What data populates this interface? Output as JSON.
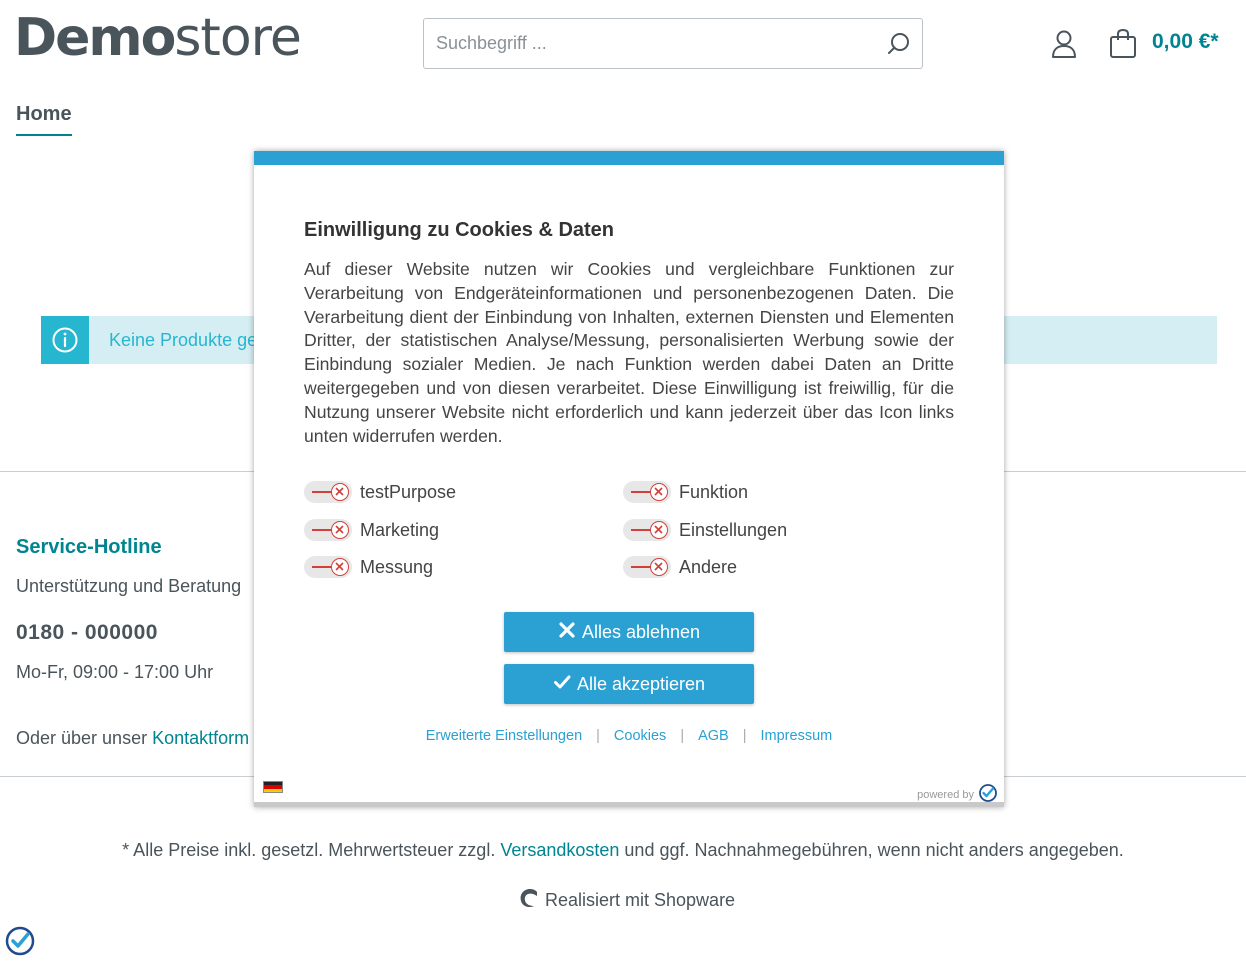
{
  "header": {
    "logo_strong": "Demo",
    "logo_light": "store",
    "search_placeholder": "Suchbegriff ...",
    "cart_total": "0,00 €*"
  },
  "nav": {
    "home": "Home"
  },
  "alert": {
    "text": "Keine Produkte ge"
  },
  "footer": {
    "hotline_title": "Service-Hotline",
    "hotline_sub": "Unterstützung und Beratung",
    "hotline_phone": "0180 - 000000",
    "hotline_hours": "Mo-Fr, 09:00 - 17:00 Uhr",
    "contact_prefix": "Oder über unser ",
    "contact_link": "Kontaktform",
    "price_note_prefix": "* Alle Preise inkl. gesetzl. Mehrwertsteuer zzgl. ",
    "price_note_link": "Versandkosten",
    "price_note_suffix": " und ggf. Nachnahmegebühren, wenn nicht anders angegeben.",
    "shopware": "Realisiert mit Shopware"
  },
  "modal": {
    "title": "Einwilligung zu Cookies & Daten",
    "body": "Auf dieser Website nutzen wir Cookies und vergleichbare Funktionen zur Verarbeitung von Endgeräteinformationen und personenbezogenen Daten. Die Verarbeitung dient der Einbindung von Inhalten, externen Diensten und Elementen Dritter, der statistischen Analyse/Messung, personalisierten Werbung sowie der Einbindung sozialer Medien. Je nach Funktion werden dabei Daten an Dritte weitergegeben und von diesen verarbeitet. Diese Einwilligung ist freiwillig, für die Nutzung unserer Website nicht erforderlich und kann jederzeit über das Icon links unten widerrufen werden.",
    "toggles": [
      {
        "label": "testPurpose",
        "checked": false
      },
      {
        "label": "Funktion",
        "checked": false
      },
      {
        "label": "Marketing",
        "checked": false
      },
      {
        "label": "Einstellungen",
        "checked": false
      },
      {
        "label": "Messung",
        "checked": false
      },
      {
        "label": "Andere",
        "checked": false
      }
    ],
    "reject_label": "Alles ablehnen",
    "accept_label": "Alle akzeptieren",
    "links": {
      "advanced": "Erweiterte Einstellungen",
      "cookies": "Cookies",
      "agb": "AGB",
      "impressum": "Impressum"
    },
    "powered_by": "powered by"
  },
  "colors": {
    "brand": "#008490",
    "consent_blue": "#2aa0d3",
    "info": "#26b6cf",
    "toggle_off": "#d0413a"
  },
  "icons": {
    "search": "search-icon",
    "account": "account-icon",
    "cart": "cart-icon",
    "info": "info-icon",
    "close": "close-icon",
    "check": "check-icon",
    "shopware": "shopware-logo-icon",
    "consent_badge": "consent-badge-icon"
  }
}
